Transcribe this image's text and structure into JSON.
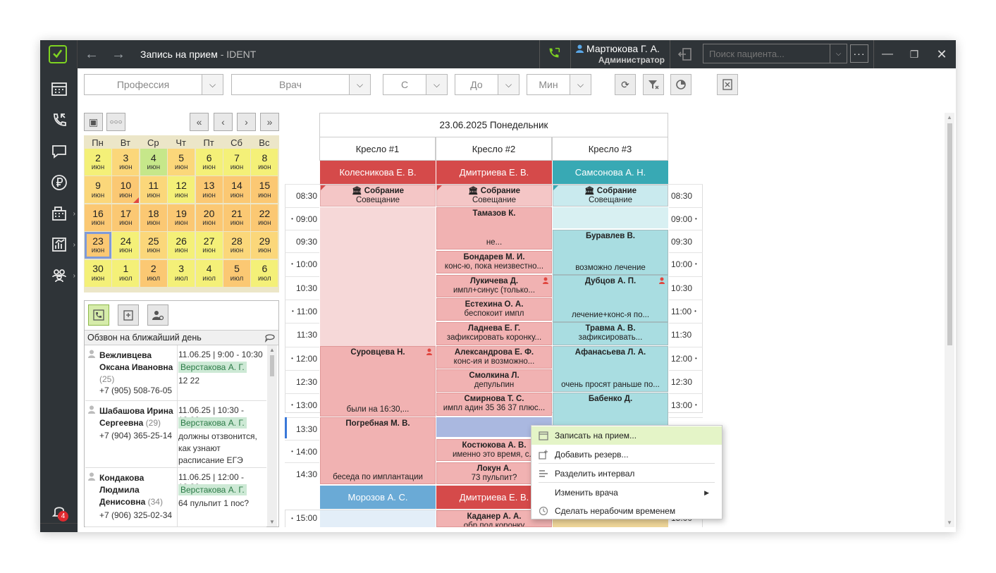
{
  "titlebar": {
    "title": "Запись на прием",
    "app_name": " - IDENT",
    "user_name": "Мартюкова Г. А.",
    "user_role": "Администратор",
    "search_placeholder": "Поиск пациента..."
  },
  "sidebar": {
    "notification_count": "4"
  },
  "filters": {
    "profession": "Профессия",
    "doctor": "Врач",
    "from": "С",
    "to": "До",
    "min": "Мин"
  },
  "calendar": {
    "weekdays": [
      "Пн",
      "Вт",
      "Ср",
      "Чт",
      "Пт",
      "Сб",
      "Вс"
    ],
    "days": [
      [
        "2",
        "июн"
      ],
      [
        "3",
        "июн"
      ],
      [
        "4",
        "июн"
      ],
      [
        "5",
        "июн"
      ],
      [
        "6",
        "июн"
      ],
      [
        "7",
        "июн"
      ],
      [
        "8",
        "июн"
      ],
      [
        "9",
        "июн"
      ],
      [
        "10",
        "июн"
      ],
      [
        "11",
        "июн"
      ],
      [
        "12",
        "июн"
      ],
      [
        "13",
        "июн"
      ],
      [
        "14",
        "июн"
      ],
      [
        "15",
        "июн"
      ],
      [
        "16",
        "июн"
      ],
      [
        "17",
        "июн"
      ],
      [
        "18",
        "июн"
      ],
      [
        "19",
        "июн"
      ],
      [
        "20",
        "июн"
      ],
      [
        "21",
        "июн"
      ],
      [
        "22",
        "июн"
      ],
      [
        "23",
        "июн"
      ],
      [
        "24",
        "июн"
      ],
      [
        "25",
        "июн"
      ],
      [
        "26",
        "июн"
      ],
      [
        "27",
        "июн"
      ],
      [
        "28",
        "июн"
      ],
      [
        "29",
        "июн"
      ],
      [
        "30",
        "июн"
      ],
      [
        "1",
        "июл"
      ],
      [
        "2",
        "июл"
      ],
      [
        "3",
        "июл"
      ],
      [
        "4",
        "июл"
      ],
      [
        "5",
        "июл"
      ],
      [
        "6",
        "июл"
      ]
    ],
    "colors": [
      "#f4f078",
      "#fbd77a",
      "#c6e78a",
      "#fbd77a",
      "#f4f078",
      "#f4f078",
      "#f4f078",
      "#fbd77a",
      "#fbc873",
      "#fbd77a",
      "#f4f078",
      "#fbc873",
      "#fbc873",
      "#fbc873",
      "#fbc873",
      "#fbc873",
      "#fbc873",
      "#fbc873",
      "#fbc873",
      "#fbc873",
      "#fbc873",
      "#fbc873",
      "#f4f078",
      "#fbd77a",
      "#f4f078",
      "#f4f078",
      "#fbd77a",
      "#fbd77a",
      "#f4f078",
      "#f4f078",
      "#fbc873",
      "#f4f078",
      "#f4f078",
      "#fbc873",
      "#f4f078"
    ],
    "selected_index": 21
  },
  "calls": {
    "title": "Обзвон на ближайший день",
    "items": [
      {
        "name": "Вежливцева Оксана Ивановна",
        "age": "(25)",
        "phone": "+7 (905) 508-76-05",
        "date": "11.06.25",
        "time": "9:00 - 10:30",
        "doctor": "Верстакова А. Г.",
        "comment": "12 22"
      },
      {
        "name": "Шабашова Ирина Сергеевна",
        "age": "(29)",
        "phone": "+7 (904) 365-25-14",
        "date": "11.06.25",
        "time": "10:30 - 12:00",
        "doctor": "Верстакова А. Г.",
        "comment": "должны отзвонится, как узнают расписание ЕГЭ"
      },
      {
        "name": "Кондакова Людмила Денисовна",
        "age": "(34)",
        "phone": "+7 (906) 325-02-34",
        "date": "11.06.25",
        "time": "12:00 - 13:30",
        "doctor": "Верстакова А. Г.",
        "comment": "64 пульпит 1 пос?"
      }
    ]
  },
  "schedule": {
    "date": "23.06.2025 Понедельник",
    "chairs": [
      "Кресло #1",
      "Кресло #2",
      "Кресло #3"
    ],
    "doctors": [
      {
        "name": "Колесникова Е. В.",
        "color": "#d54a4a"
      },
      {
        "name": "Дмитриева Е. В.",
        "color": "#d54a4a"
      },
      {
        "name": "Самсонова А. Н.",
        "color": "#38a9b4"
      }
    ],
    "doctors2": [
      {
        "name": "Морозов А. С.",
        "color": "#6aaad6"
      },
      {
        "name": "Дмитриева Е. В.",
        "color": "#d54a4a"
      }
    ],
    "times": [
      "08:30",
      "09:00",
      "09:30",
      "10:00",
      "10:30",
      "11:00",
      "11:30",
      "12:00",
      "12:30",
      "13:00",
      "13:30",
      "14:00",
      "14:30"
    ],
    "time_1500": "15:00",
    "meeting": {
      "name": "Собрание",
      "comment": "Совещание"
    },
    "col1": [
      {
        "name": "Суровцева Н.",
        "comment": "были на 16:30,..."
      },
      {
        "name": "Погребная М. В.",
        "comment": "беседа по имплантации"
      }
    ],
    "col2": [
      {
        "name": "Тамазов К.",
        "comment": "не..."
      },
      {
        "name": "Бондарев М. И.",
        "comment": "конс-ю, пока неизвестно..."
      },
      {
        "name": "Лукичева Д.",
        "comment": "импл+синус (только..."
      },
      {
        "name": "Естехина О. А.",
        "comment": "беспокоит импл"
      },
      {
        "name": "Ладнева Е. Г.",
        "comment": "зафиксировать коронку..."
      },
      {
        "name": "Александрова Е. Ф.",
        "comment": "конс-ия и возможно..."
      },
      {
        "name": "Смолкина Л.",
        "comment": "депульпин"
      },
      {
        "name": "Смирнова Т. С.",
        "comment": "импл адин 35 36 37 плюс..."
      },
      {
        "name": "Костюкова А. В.",
        "comment": "именно это время, с..."
      },
      {
        "name": "Локун А.",
        "comment": "73 пульпит?"
      },
      {
        "name": "Каданер А. А.",
        "comment": "обр под коронку"
      }
    ],
    "col3": [
      {
        "name": "Буравлев В.",
        "comment": "возможно лечение"
      },
      {
        "name": "Дубцов А. П.",
        "comment": "лечение+конс-я по..."
      },
      {
        "name": "Травма А. В.",
        "comment": "зафиксировать..."
      },
      {
        "name": "Афанасьева Л. А.",
        "comment": "очень просят раньше по..."
      },
      {
        "name": "Бабенко Д.",
        "comment": ""
      }
    ]
  },
  "context_menu": {
    "items": [
      "Записать на прием...",
      "Добавить резерв...",
      "Разделить интервал",
      "Изменить врача",
      "Сделать нерабочим временем"
    ]
  }
}
